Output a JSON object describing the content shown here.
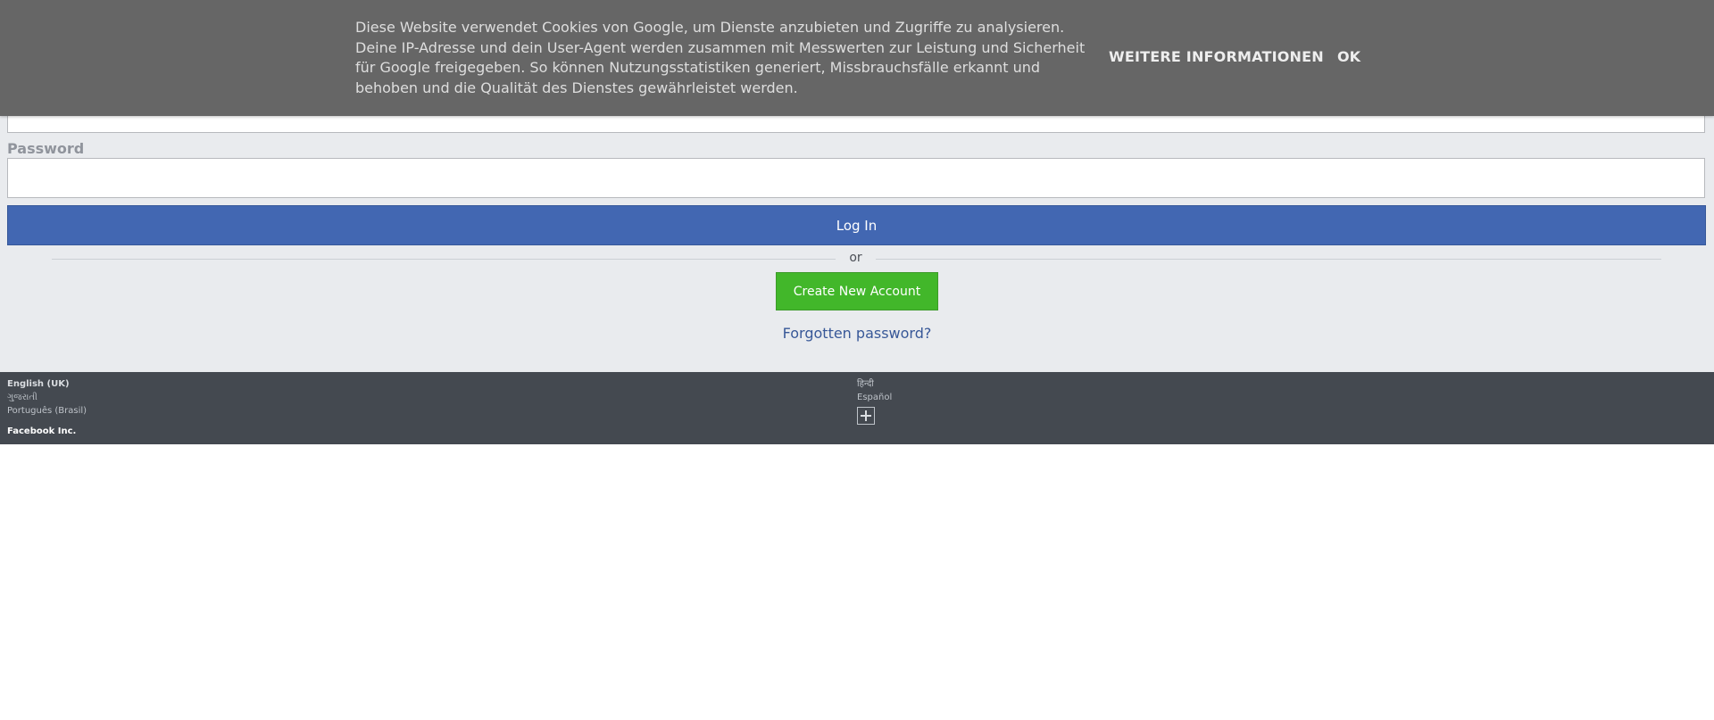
{
  "cookie_banner": {
    "text": "Diese Website verwendet Cookies von Google, um Dienste anzubieten und Zugriffe zu analysieren. Deine IP-Adresse und dein User-Agent werden zusammen mit Messwerten zur Leistung und Sicherheit für Google freigegeben. So können Nutzungsstatistiken generiert, Missbrauchsfälle erkannt und behoben und die Qualität des Dienstes gewährleistet werden.",
    "more_info_label": "WEITERE INFORMATIONEN",
    "ok_label": "OK"
  },
  "login": {
    "username_value": "",
    "password_label": "Password",
    "password_value": "",
    "login_button": "Log In",
    "divider_text": "or",
    "create_account_button": "Create New Account",
    "forgotten_password_link": "Forgotten password?"
  },
  "footer": {
    "languages_left": [
      "English (UK)",
      "ગુજરાતી",
      "Português (Brasil)"
    ],
    "languages_right": [
      "हिन्दी",
      "Español"
    ],
    "more_languages_icon": "plus-icon",
    "company": "Facebook Inc."
  },
  "colors": {
    "login_button": "#4267b2",
    "create_account_button": "#42b72a",
    "link": "#385898",
    "cookie_banner_bg": "#666666",
    "footer_bg": "#444950",
    "page_bg": "#e9ebee"
  }
}
